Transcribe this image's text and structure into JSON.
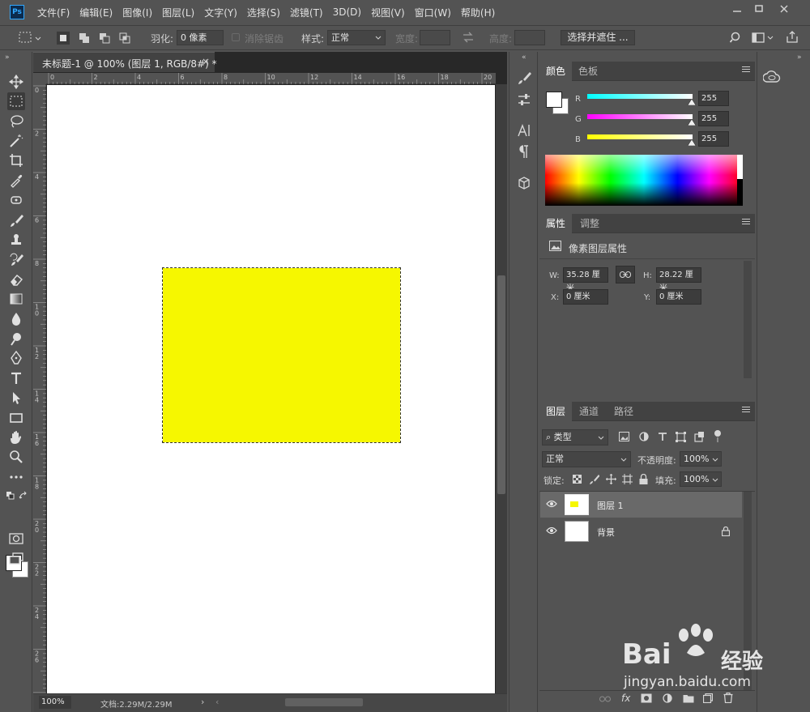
{
  "app": {
    "logo": "Ps",
    "menu": [
      "文件(F)",
      "编辑(E)",
      "图像(I)",
      "图层(L)",
      "文字(Y)",
      "选择(S)",
      "滤镜(T)",
      "3D(D)",
      "视图(V)",
      "窗口(W)",
      "帮助(H)"
    ]
  },
  "options": {
    "feather_label": "羽化:",
    "feather_value": "0 像素",
    "antialias_label": "消除锯齿",
    "style_label": "样式:",
    "style_value": "正常",
    "width_label": "宽度:",
    "height_label": "高度:",
    "select_mask_label": "选择并遮住 ..."
  },
  "document": {
    "tab_title": "未标题-1 @ 100% (图层 1, RGB/8#) *",
    "close_glyph": "×",
    "ruler_top": [
      "0",
      "2",
      "4",
      "6",
      "8",
      "10",
      "12",
      "14",
      "16",
      "18",
      "20"
    ],
    "ruler_left": [
      "0",
      "2",
      "4",
      "6",
      "8",
      "1\n0",
      "1\n2",
      "1\n4",
      "1\n6",
      "1\n8",
      "2\n0",
      "2\n2",
      "2\n4",
      "2\n6",
      "2\n8"
    ],
    "zoom": "100%",
    "doc_info": "文档:2.29M/2.29M",
    "shape_color": "#f6f700"
  },
  "color_panel": {
    "tabs": [
      "颜色",
      "色板"
    ],
    "channels": [
      {
        "label": "R",
        "value": "255",
        "gradient": "#00ffff",
        "gradient_end": "#ffffff"
      },
      {
        "label": "G",
        "value": "255",
        "gradient": "#ff00ff",
        "gradient_end": "#ffffff"
      },
      {
        "label": "B",
        "value": "255",
        "gradient": "#ffff00",
        "gradient_end": "#ffffff"
      }
    ]
  },
  "properties_panel": {
    "tabs": [
      "属性",
      "调整"
    ],
    "heading": "像素图层属性",
    "w_label": "W:",
    "w_value": "35.28 厘米",
    "h_label": "H:",
    "h_value": "28.22 厘米",
    "x_label": "X:",
    "x_value": "0 厘米",
    "y_label": "Y:",
    "y_value": "0 厘米"
  },
  "layers_panel": {
    "tabs": [
      "图层",
      "通道",
      "路径"
    ],
    "filter_label": "类型",
    "blend_mode": "正常",
    "opacity_label": "不透明度:",
    "opacity_value": "100%",
    "lock_label": "锁定:",
    "fill_label": "填充:",
    "fill_value": "100%",
    "layers": [
      {
        "name": "图层 1",
        "selected": true
      },
      {
        "name": "背景",
        "selected": false
      }
    ]
  },
  "watermark": {
    "brand": "Bai",
    "brand_suffix": "经验",
    "url": "jingyan.baidu.com"
  }
}
